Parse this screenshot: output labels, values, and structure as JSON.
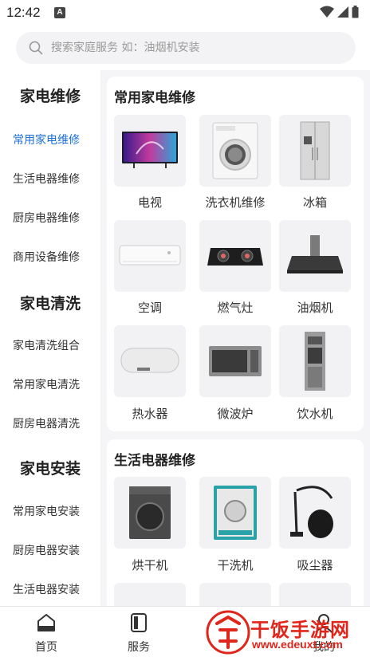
{
  "status_bar": {
    "time": "12:42",
    "badge": "A"
  },
  "search": {
    "placeholder": "搜索家庭服务 如：油烟机安装"
  },
  "sidebar": {
    "groups": [
      {
        "title": "家电维修",
        "items": [
          "常用家电维修",
          "生活电器维修",
          "厨房电器维修",
          "商用设备维修"
        ]
      },
      {
        "title": "家电清洗",
        "items": [
          "家电清洗组合",
          "常用家电清洗",
          "厨房电器清洗"
        ]
      },
      {
        "title": "家电安装",
        "items": [
          "常用家电安装",
          "厨房电器安装",
          "生活电器安装"
        ]
      }
    ],
    "active_item": "常用家电维修"
  },
  "sections": [
    {
      "title": "常用家电维修",
      "items": [
        {
          "label": "电视",
          "icon": "tv-icon"
        },
        {
          "label": "洗衣机维修",
          "icon": "washing-machine-icon"
        },
        {
          "label": "冰箱",
          "icon": "fridge-icon"
        },
        {
          "label": "空调",
          "icon": "air-conditioner-icon"
        },
        {
          "label": "燃气灶",
          "icon": "gas-stove-icon"
        },
        {
          "label": "油烟机",
          "icon": "range-hood-icon"
        },
        {
          "label": "热水器",
          "icon": "water-heater-icon"
        },
        {
          "label": "微波炉",
          "icon": "microwave-icon"
        },
        {
          "label": "饮水机",
          "icon": "water-dispenser-icon"
        }
      ]
    },
    {
      "title": "生活电器维修",
      "items": [
        {
          "label": "烘干机",
          "icon": "dryer-icon"
        },
        {
          "label": "干洗机",
          "icon": "dry-cleaner-icon"
        },
        {
          "label": "吸尘器",
          "icon": "vacuum-icon"
        }
      ]
    }
  ],
  "bottom_nav": {
    "home": "首页",
    "service": "服务",
    "mine": "我的"
  },
  "watermark": {
    "text": "干饭手游网",
    "url": "www.edeuxt.com",
    "logo": "饭"
  },
  "colors": {
    "accent": "#1a6fd8",
    "watermark": "#e0251b"
  }
}
